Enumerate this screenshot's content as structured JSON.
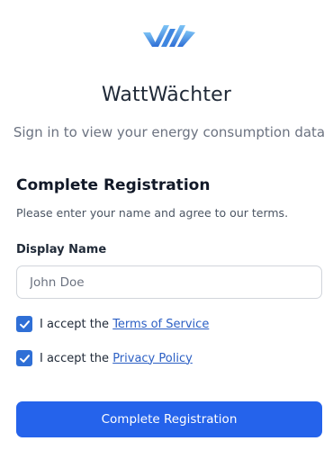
{
  "brand": {
    "logo_icon": "wattwachter-logo-icon",
    "accent_color": "#2563eb",
    "title": "WattWächter",
    "subtitle": "Sign in to view your energy consumption data"
  },
  "registration": {
    "title": "Complete Registration",
    "description": "Please enter your name and agree to our terms.",
    "display_name": {
      "label": "Display Name",
      "value": "",
      "placeholder": "John Doe"
    },
    "terms": {
      "checked": true,
      "prefix": "I accept the ",
      "link_text": "Terms of Service"
    },
    "privacy": {
      "checked": true,
      "prefix": "I accept the ",
      "link_text": "Privacy Policy"
    },
    "submit_label": "Complete Registration"
  }
}
